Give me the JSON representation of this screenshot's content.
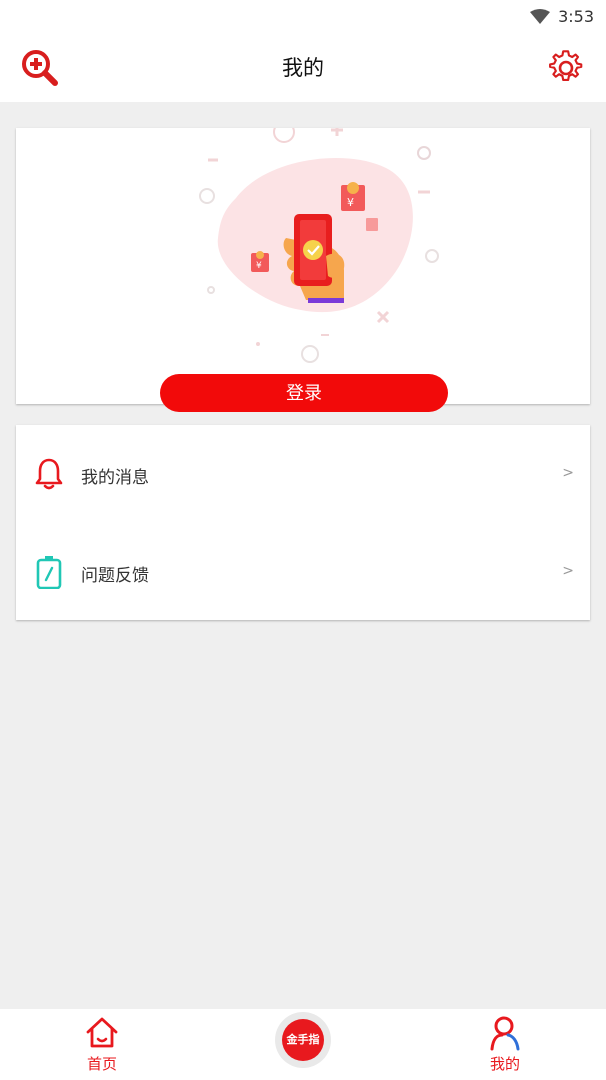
{
  "status_bar": {
    "time": "3:53",
    "icons": [
      "wifi-icon"
    ]
  },
  "header": {
    "title": "我的",
    "left_icon": "zoom-in-search-icon",
    "right_icon": "gear-icon"
  },
  "login": {
    "button_label": "登录",
    "illustration": "phone-red-envelope-illustration",
    "accent": "#f20a0a"
  },
  "menu": {
    "items": [
      {
        "label": "我的消息",
        "icon": "bell-icon",
        "chevron": ">",
        "icon_color": "#e8191e"
      },
      {
        "label": "问题反馈",
        "icon": "feedback-pencil-icon",
        "chevron": ">",
        "icon_color": "#20c7b5"
      }
    ]
  },
  "tab_bar": {
    "items": [
      {
        "label": "首页",
        "icon": "home-icon"
      },
      {
        "label": "金手指",
        "icon": "center-logo"
      },
      {
        "label": "我的",
        "icon": "person-icon",
        "active": true
      }
    ],
    "active_color": "#e8191e"
  }
}
